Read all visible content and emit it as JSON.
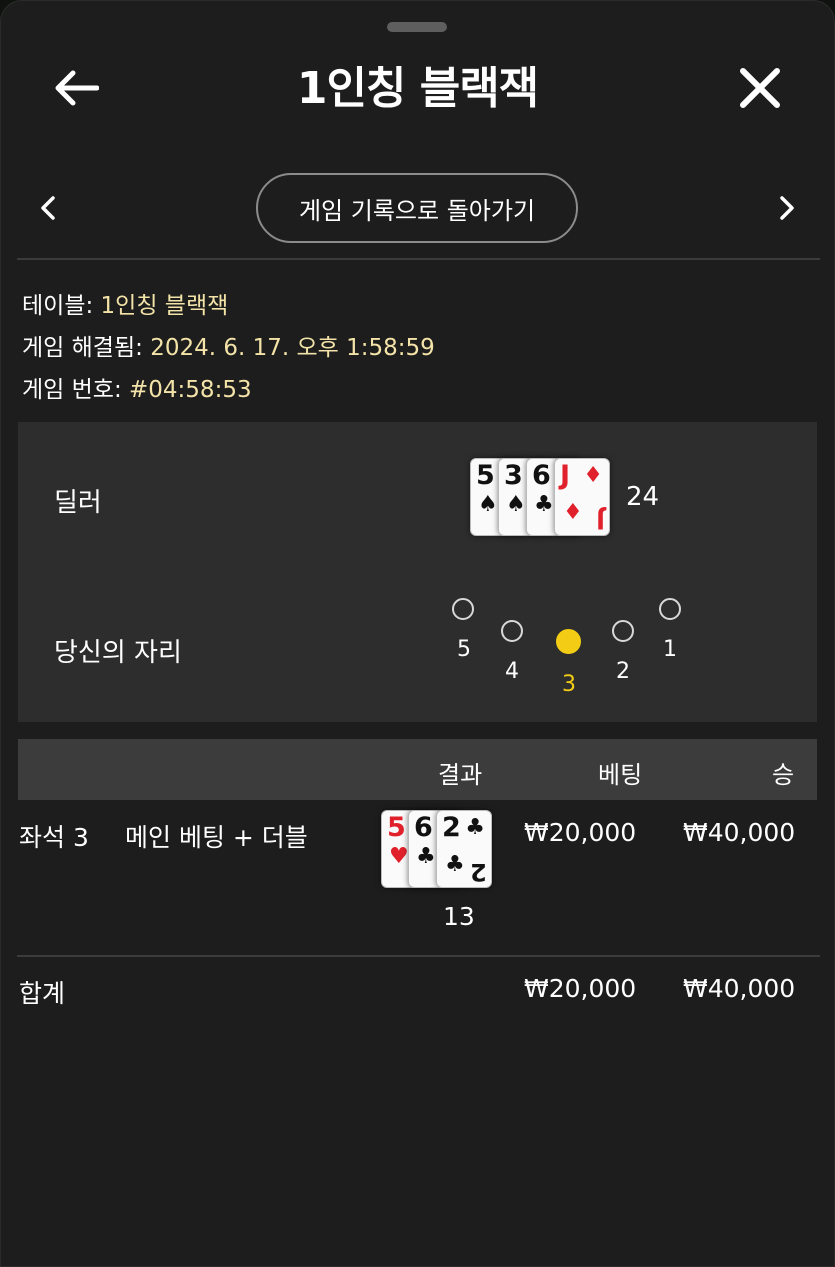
{
  "header": {
    "title": "1인칭 블랙잭",
    "back_icon": "arrow-left-icon",
    "close_icon": "close-icon"
  },
  "nav": {
    "prev_icon": "chevron-left-icon",
    "next_icon": "chevron-right-icon",
    "back_to_history": "게임 기록으로 돌아가기"
  },
  "info": {
    "table_label": "테이블:",
    "table_value": "1인칭 블랙잭",
    "resolved_label": "게임 해결됨:",
    "resolved_value": "2024. 6. 17. 오후 1:58:59",
    "game_no_label": "게임 번호:",
    "game_no_value": "#04:58:53"
  },
  "dealer": {
    "label": "딜러",
    "cards": [
      {
        "rank": "5",
        "suit": "♠"
      },
      {
        "rank": "3",
        "suit": "♠"
      },
      {
        "rank": "6",
        "suit": "♣"
      },
      {
        "rank": "J",
        "suit": "♦"
      }
    ],
    "total": "24"
  },
  "seats": {
    "label": "당신의 자리",
    "list": [
      "5",
      "4",
      "3",
      "2",
      "1"
    ],
    "selected": "3"
  },
  "table": {
    "headers": {
      "result": "결과",
      "bet": "베팅",
      "win": "승"
    },
    "row": {
      "seat": "좌석 3",
      "bet_type": "메인 베팅 + 더블",
      "cards": [
        {
          "rank": "5",
          "suit": "♥"
        },
        {
          "rank": "6",
          "suit": "♣"
        },
        {
          "rank": "2",
          "suit": "♣"
        }
      ],
      "total": "13",
      "bet": "₩20,000",
      "win": "₩40,000"
    },
    "total_row": {
      "label": "합계",
      "bet": "₩20,000",
      "win": "₩40,000"
    }
  },
  "colors": {
    "accent": "#f3cd15",
    "info_value": "#f3e3a8",
    "red_suit": "#e0212b"
  }
}
